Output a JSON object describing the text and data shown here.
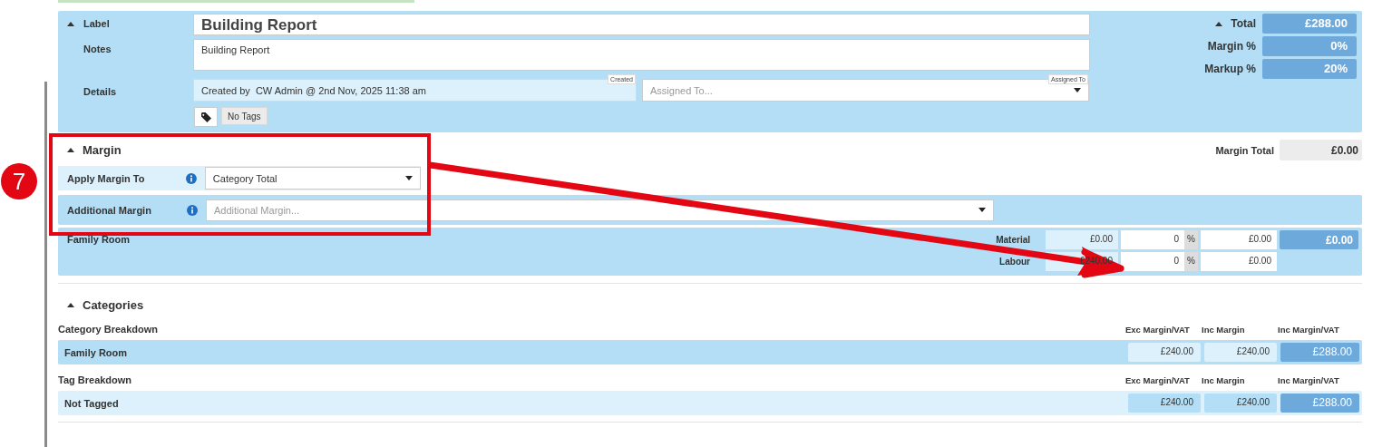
{
  "annotation": {
    "step": "7"
  },
  "details": {
    "expanded": true,
    "label": "Label",
    "title": "Building Report",
    "notes_label": "Notes",
    "notes": "Building Report",
    "details_label": "Details",
    "created": "Created by  CW Admin @ 2nd Nov, 2025 11:38 am",
    "created_badge": "Created",
    "assigned_placeholder": "Assigned To...",
    "assigned_badge": "Assigned To",
    "tags": "No Tags"
  },
  "totals": {
    "expanded": true,
    "rows": [
      {
        "label": "Total",
        "value": "£288.00"
      },
      {
        "label": "Margin %",
        "value": "0%"
      },
      {
        "label": "Markup %",
        "value": "20%"
      }
    ]
  },
  "margin": {
    "expanded": true,
    "title": "Margin",
    "total_label": "Margin Total",
    "total": "£0.00",
    "apply_label": "Apply Margin To",
    "apply_value": "Category Total",
    "additional_label": "Additional Margin",
    "additional_placeholder": "Additional Margin...",
    "category": {
      "name": "Family Room",
      "total": "£0.00",
      "rows": [
        {
          "label": "Material",
          "cost": "£0.00",
          "percent": "0",
          "percent_sign": "%",
          "amount": "£0.00"
        },
        {
          "label": "Labour",
          "cost": "£240.00",
          "percent": "0",
          "percent_sign": "%",
          "amount": "£0.00"
        }
      ]
    }
  },
  "categories": {
    "expanded": true,
    "title": "Categories",
    "groups": [
      {
        "title": "Category Breakdown",
        "kind": "category",
        "columns": [
          "Exc Margin/VAT",
          "Inc Margin",
          "Inc Margin/VAT"
        ],
        "rows": [
          {
            "name": "Family Room",
            "values": [
              "£240.00",
              "£240.00",
              "£288.00"
            ]
          }
        ]
      },
      {
        "title": "Tag Breakdown",
        "kind": "tag",
        "columns": [
          "Exc Margin/VAT",
          "Inc Margin",
          "Inc Margin/VAT"
        ],
        "rows": [
          {
            "name": "Not Tagged",
            "values": [
              "£240.00",
              "£240.00",
              "£288.00"
            ]
          }
        ]
      }
    ]
  }
}
